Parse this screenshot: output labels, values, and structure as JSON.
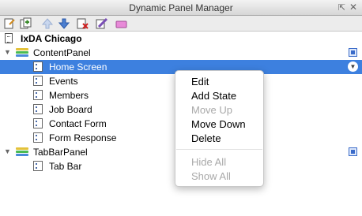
{
  "window": {
    "title": "Dynamic Panel Manager",
    "pin_icon": "pin-icon",
    "close_icon": "close-icon"
  },
  "toolbar": {
    "buttons": [
      "add-state-icon",
      "duplicate-state-icon",
      "move-up-icon",
      "move-down-icon",
      "delete-icon",
      "edit-icon",
      "eraser-icon"
    ]
  },
  "tree": {
    "page": "IxDA Chicago",
    "panels": [
      {
        "name": "ContentPanel",
        "states": [
          "Home Screen",
          "Events",
          "Members",
          "Job Board",
          "Contact Form",
          "Form Response"
        ],
        "selected": "Home Screen"
      },
      {
        "name": "TabBarPanel",
        "states": [
          "Tab Bar"
        ]
      }
    ]
  },
  "context_menu": {
    "items": [
      {
        "label": "Edit",
        "enabled": true
      },
      {
        "label": "Add State",
        "enabled": true
      },
      {
        "label": "Move Up",
        "enabled": false
      },
      {
        "label": "Move Down",
        "enabled": true
      },
      {
        "label": "Delete",
        "enabled": true
      },
      {
        "label": "Hide All",
        "enabled": false
      },
      {
        "label": "Show All",
        "enabled": false
      }
    ]
  },
  "colors": {
    "selection": "#3d80df",
    "disabled_text": "#a9a9a9"
  }
}
